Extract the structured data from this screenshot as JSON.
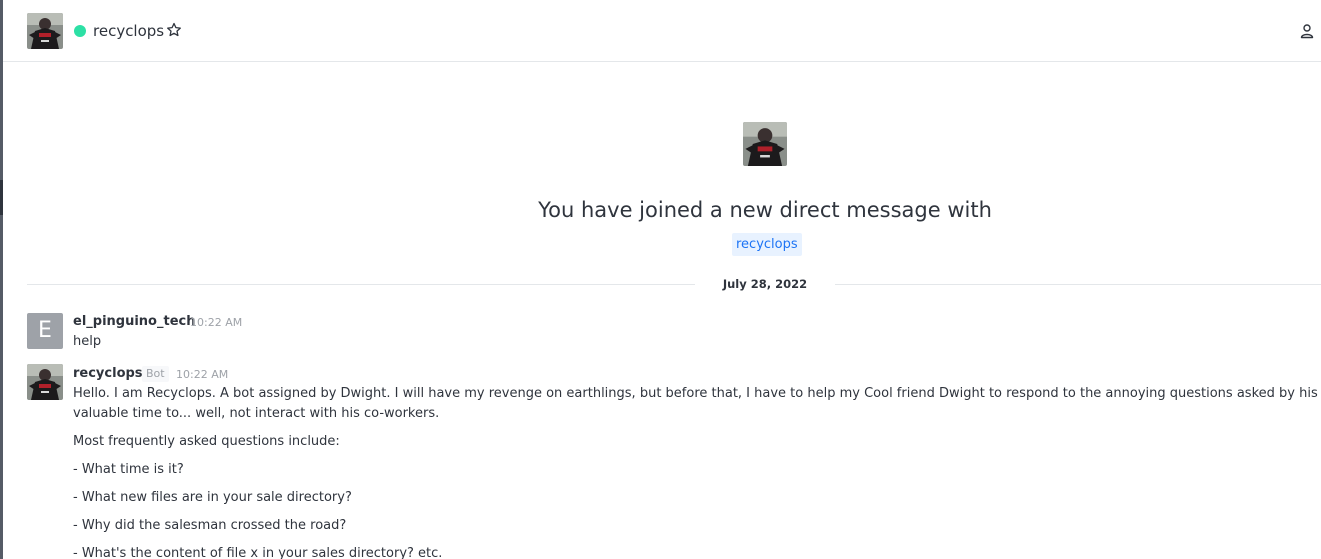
{
  "header": {
    "room_name": "recyclops",
    "status_color": "#2de0a5"
  },
  "welcome": {
    "text": "You have joined a new direct message with",
    "mention": "recyclops"
  },
  "date_divider": "July 28, 2022",
  "messages": [
    {
      "avatar_letter": "E",
      "username": "el_pinguino_tech",
      "time": "10:22 AM",
      "lines": [
        "help"
      ]
    },
    {
      "username": "recyclops",
      "tag": "Bot",
      "time": "10:22 AM",
      "lines": [
        "Hello. I am Recyclops. A bot assigned by Dwight. I will have my revenge on earthlings, but before that, I have to help my Cool friend Dwight to respond to the annoying questions asked by his co-workers, so that he may use his",
        "valuable time to... well, not interact with his co-workers.",
        "Most frequently asked questions include:",
        "- What time is it?",
        "- What new files are in your sale directory?",
        "- Why did the salesman crossed the road?",
        "- What's the content of file x in your sales directory? etc."
      ]
    }
  ],
  "icons": {
    "favorite": "star-icon",
    "members": "user-icon",
    "presence": "status-dot"
  }
}
